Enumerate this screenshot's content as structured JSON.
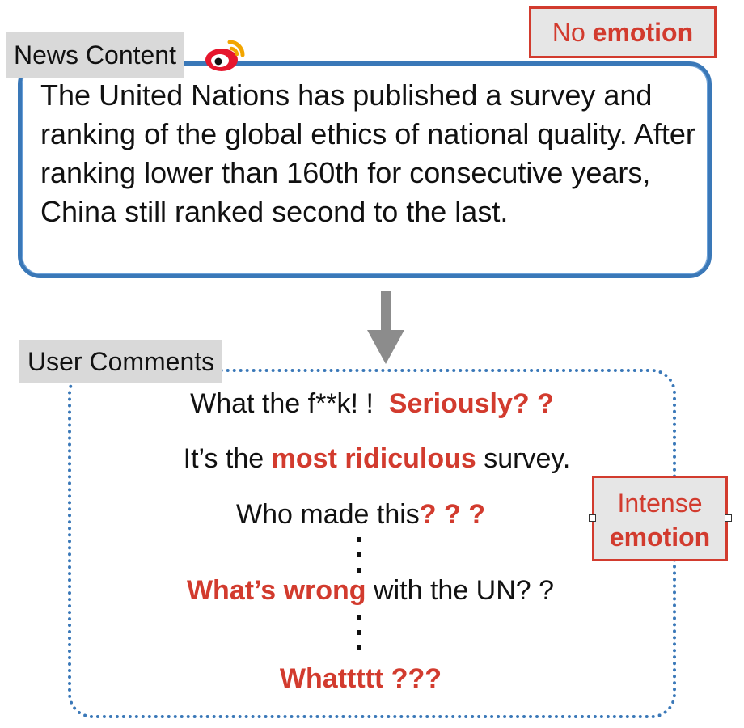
{
  "news": {
    "tag": "News Content",
    "text": "The United Nations has published a survey and ranking of the global ethics of national quality. After ranking lower than 160th for consecutive years, China still ranked second to the last."
  },
  "labels": {
    "no_emotion_prefix": "No",
    "no_emotion_bold": "emotion",
    "intense_line1": "Intense",
    "intense_line2": "emotion"
  },
  "comments": {
    "tag": "User Comments",
    "c1_plain": "What the f**k! !",
    "c1_red": "Seriously? ?",
    "c2_pre": "It’s the",
    "c2_red": "most ridiculous",
    "c2_post": "survey.",
    "c3_plain": "Who made this",
    "c3_red": "? ? ?",
    "c4_red": "What’s wrong",
    "c4_plain": "with the UN? ?",
    "c5_red": "Whattttt ???"
  },
  "colors": {
    "accent_blue": "#3a78b8",
    "accent_red": "#d23b2e",
    "tag_gray": "#d9d9d9"
  },
  "icons": {
    "weibo": "weibo-logo-icon",
    "arrow": "down-arrow-icon"
  }
}
